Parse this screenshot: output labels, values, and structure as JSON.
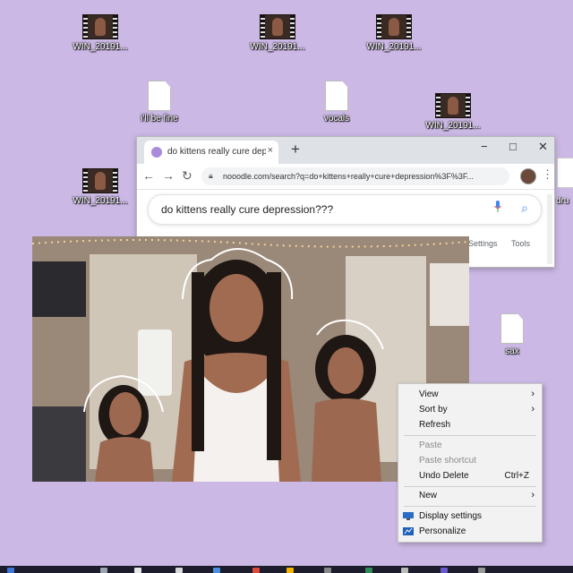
{
  "desktop": {
    "icons": [
      {
        "label": "WIN_20191...",
        "type": "video"
      },
      {
        "label": "WIN_20191...",
        "type": "video"
      },
      {
        "label": "WIN_20191...",
        "type": "video"
      },
      {
        "label": "i'll be fine",
        "type": "document"
      },
      {
        "label": "vocals",
        "type": "document"
      },
      {
        "label": "WIN_20191...",
        "type": "video"
      },
      {
        "label": "WIN_20191...",
        "type": "video"
      },
      {
        "label": "sax",
        "type": "document"
      },
      {
        "label": "dru",
        "type": "document"
      }
    ]
  },
  "browser": {
    "tab_title": "do kittens really cure depression",
    "tab_close": "×",
    "new_tab": "+",
    "window_controls": {
      "minimize": "−",
      "maximize": "□",
      "close": "✕"
    },
    "nav": {
      "back": "←",
      "forward": "→",
      "reload": "↻"
    },
    "url": "nooodle.com/search?q=do+kittens+really+cure+depression%3F%3F...",
    "search_query": "do kittens really cure depression???",
    "links": {
      "settings": "Settings",
      "tools": "Tools"
    },
    "menu": "⋮"
  },
  "context_menu": {
    "items": [
      {
        "label": "View",
        "submenu": true,
        "disabled": false
      },
      {
        "label": "Sort by",
        "submenu": true,
        "disabled": false
      },
      {
        "label": "Refresh",
        "submenu": false,
        "disabled": false
      },
      {
        "label": "Paste",
        "submenu": false,
        "disabled": true
      },
      {
        "label": "Paste shortcut",
        "submenu": false,
        "disabled": true
      },
      {
        "label": "Undo Delete",
        "shortcut": "Ctrl+Z",
        "submenu": false,
        "disabled": false
      },
      {
        "label": "New",
        "submenu": true,
        "disabled": false
      },
      {
        "label": "Display settings",
        "icon": "display-icon",
        "submenu": false,
        "disabled": false
      },
      {
        "label": "Personalize",
        "icon": "personalize-icon",
        "submenu": false,
        "disabled": false
      }
    ],
    "submenu_arrow": "›"
  },
  "colors": {
    "desktop_bg": "#cbb8e4",
    "accent_search": "#4285f4",
    "favicon": "#a98bdb"
  }
}
